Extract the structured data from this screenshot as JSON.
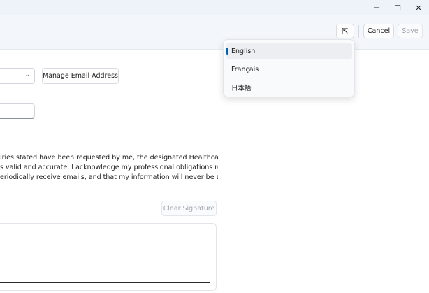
{
  "window_controls": {
    "minimize_glyph": "—",
    "maximize_glyph": "☐",
    "close_glyph": "✕"
  },
  "toolbar": {
    "collapse_glyph": "⇱",
    "cancel_label": "Cancel",
    "save_label": "Save"
  },
  "form": {
    "dropdown_chevron": "⌄",
    "manage_email_label": "Manage Email Address",
    "paragraph_lines": [
      "iries stated have been requested by me, the designated Healthcare",
      "s valid and accurate. I acknowledge my professional obligations regarding",
      "eriodically receive emails, and that my information will never be sold or"
    ],
    "clear_signature_label": "Clear Signature"
  },
  "language_menu": {
    "items": [
      {
        "label": "English",
        "selected": true
      },
      {
        "label": "Français",
        "selected": false
      },
      {
        "label": "日本語",
        "selected": false
      }
    ]
  },
  "colors": {
    "accent": "#005fb8",
    "background": "#eef3f9",
    "surface": "#ffffff"
  }
}
